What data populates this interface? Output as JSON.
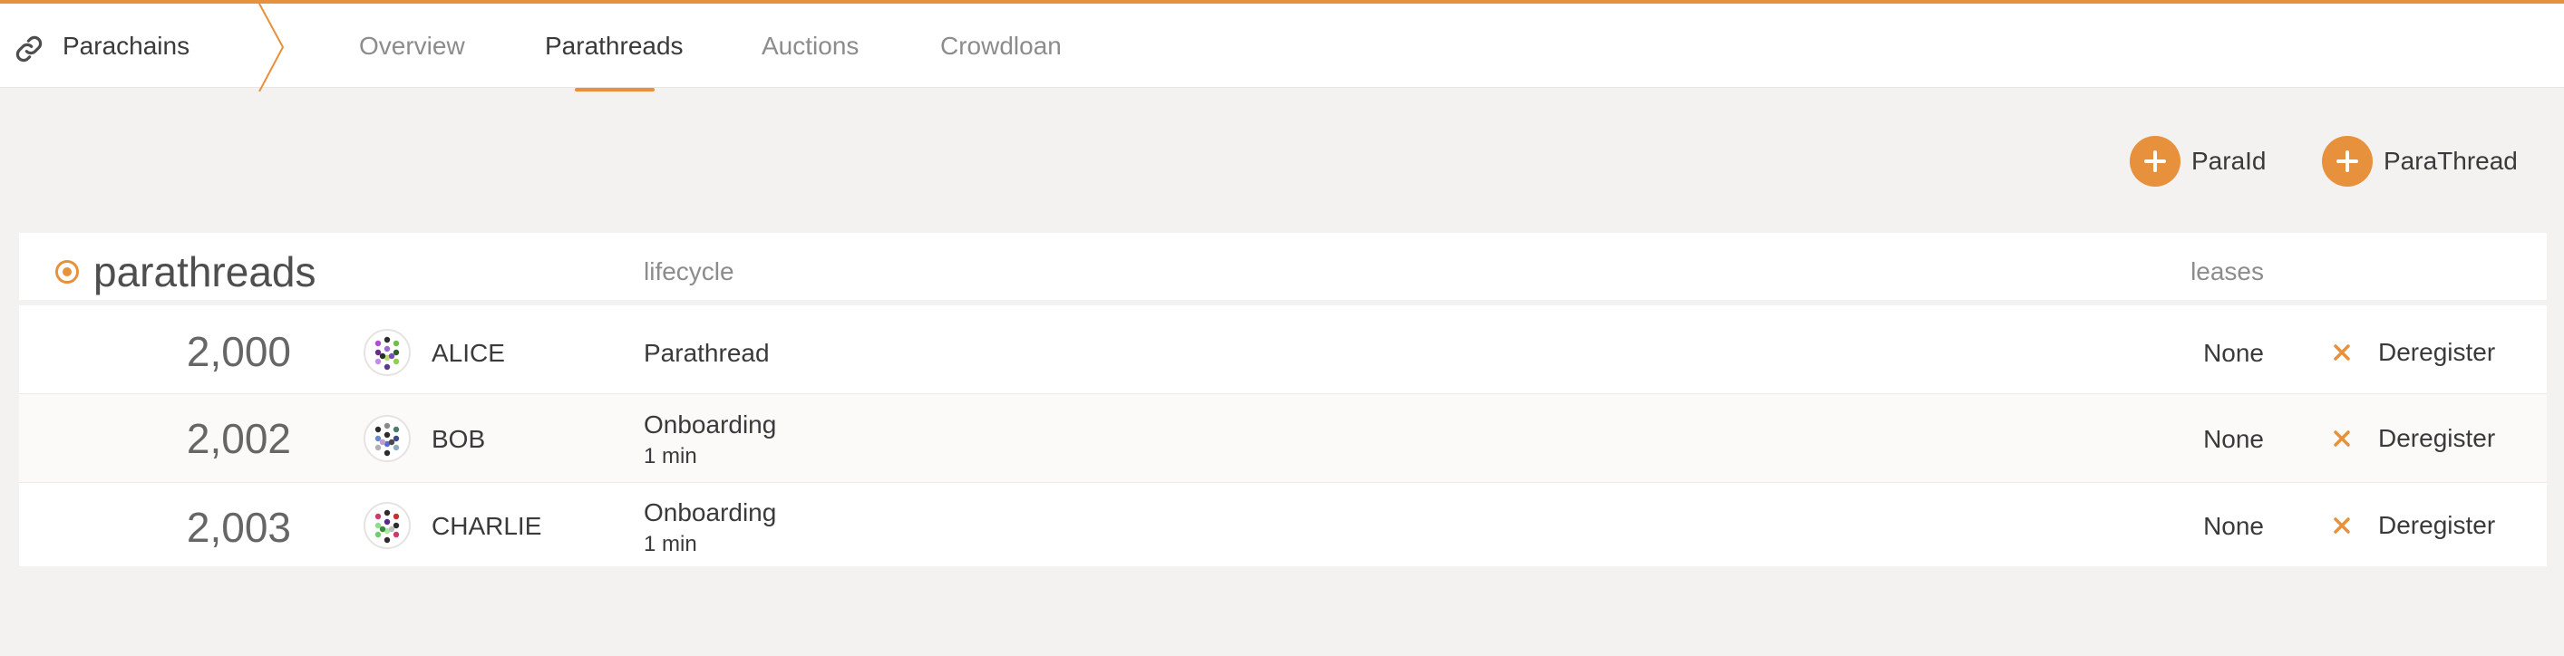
{
  "header": {
    "section_label": "Parachains",
    "section_icon": "link-icon",
    "tabs": [
      {
        "label": "Overview",
        "active": false
      },
      {
        "label": "Parathreads",
        "active": true
      },
      {
        "label": "Auctions",
        "active": false
      },
      {
        "label": "Crowdloan",
        "active": false
      }
    ],
    "accent_color": "#e8913c"
  },
  "actions": {
    "paraid_label": "ParaId",
    "parathread_label": "ParaThread"
  },
  "table": {
    "title": "parathreads",
    "col_lifecycle": "lifecycle",
    "col_leases": "leases",
    "rows": [
      {
        "id": "2,000",
        "name": "ALICE",
        "lifecycle": "Parathread",
        "lifecycle_sub": "",
        "leases": "None",
        "action": "Deregister"
      },
      {
        "id": "2,002",
        "name": "BOB",
        "lifecycle": "Onboarding",
        "lifecycle_sub": "1 min",
        "leases": "None",
        "action": "Deregister"
      },
      {
        "id": "2,003",
        "name": "CHARLIE",
        "lifecycle": "Onboarding",
        "lifecycle_sub": "1 min",
        "leases": "None",
        "action": "Deregister"
      }
    ]
  }
}
